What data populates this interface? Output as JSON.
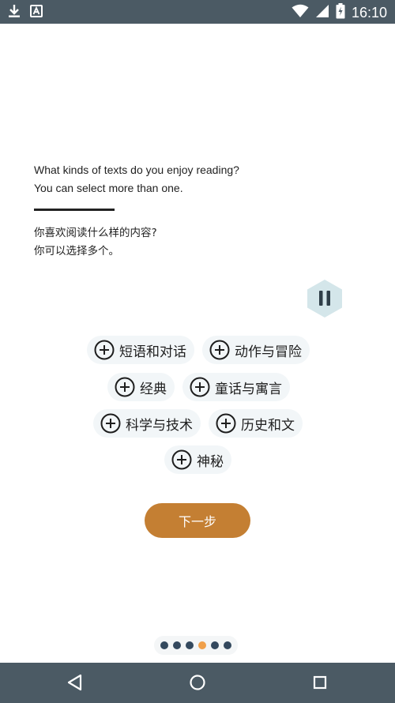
{
  "status_bar": {
    "time": "16:10",
    "left_icons": [
      "download-icon",
      "a-icon"
    ],
    "right_icons": [
      "wifi-icon",
      "signal-icon",
      "battery-icon"
    ]
  },
  "prompt": {
    "en_line1": "What kinds of texts do you enjoy reading?",
    "en_line2": "You can select more than one.",
    "zh_line1": "你喜欢阅读什么样的内容?",
    "zh_line2": "你可以选择多个。"
  },
  "pause_button": {
    "icon": "pause-icon",
    "color": "#d4e6ea"
  },
  "chips": [
    {
      "label": "短语和对话"
    },
    {
      "label": "动作与冒险"
    },
    {
      "label": "经典"
    },
    {
      "label": "童话与寓言"
    },
    {
      "label": "科学与技术"
    },
    {
      "label": "历史和文"
    },
    {
      "label": "神秘"
    }
  ],
  "next_button": {
    "label": "下一步",
    "color": "#c47f33"
  },
  "pager": {
    "total": 6,
    "current": 4,
    "active_color": "#f0a04b",
    "inactive_color": "#34495e"
  },
  "nav_bar": {
    "buttons": [
      "back-icon",
      "home-icon",
      "recents-icon"
    ]
  }
}
